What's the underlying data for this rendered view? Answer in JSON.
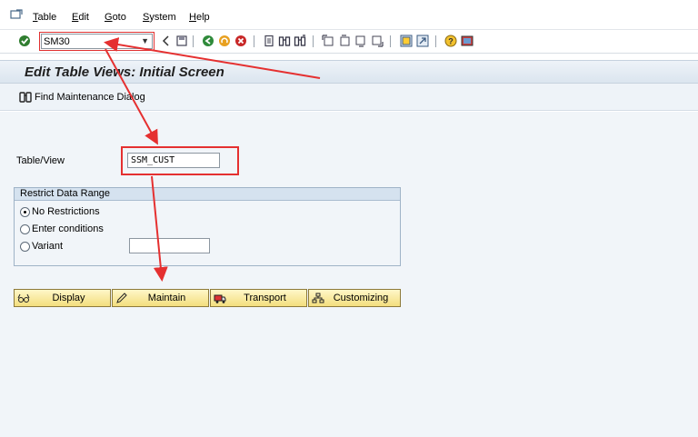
{
  "menu": {
    "items": [
      {
        "label": "Table",
        "mnemonic": "T",
        "rest": "able"
      },
      {
        "label": "Edit",
        "mnemonic": "E",
        "rest": "dit"
      },
      {
        "label": "Goto",
        "mnemonic": "G",
        "rest": "oto"
      },
      {
        "label": "System",
        "mnemonic": "S",
        "rest": "ystem"
      },
      {
        "label": "Help",
        "mnemonic": "H",
        "rest": "elp"
      }
    ]
  },
  "toolbar": {
    "command_value": "SM30",
    "icons": [
      "enter-icon",
      "back-icon",
      "save-icon",
      "back-green-icon",
      "exit-icon",
      "cancel-icon",
      "print-icon",
      "find-icon",
      "find-next-icon",
      "first-page-icon",
      "previous-page-icon",
      "next-page-icon",
      "last-page-icon",
      "create-session-icon",
      "shortcut-icon",
      "help-icon",
      "layout-icon"
    ]
  },
  "screen": {
    "title": "Edit Table Views: Initial Screen",
    "find_button": "Find Maintenance Dialog"
  },
  "form": {
    "table_view_label": "Table/View",
    "table_view_value": "SSM_CUST",
    "restrict_group_title": "Restrict Data Range",
    "options": [
      {
        "label": "No Restrictions",
        "selected": true
      },
      {
        "label": "Enter conditions",
        "selected": false
      },
      {
        "label": "Variant",
        "selected": false
      }
    ],
    "variant_value": ""
  },
  "buttons": {
    "display": "Display",
    "maintain": "Maintain",
    "transport": "Transport",
    "customizing": "Customizing"
  },
  "colors": {
    "annotation": "#e53030",
    "button_fill": "#f3de7e",
    "title_bg": "#dbe5ef"
  }
}
